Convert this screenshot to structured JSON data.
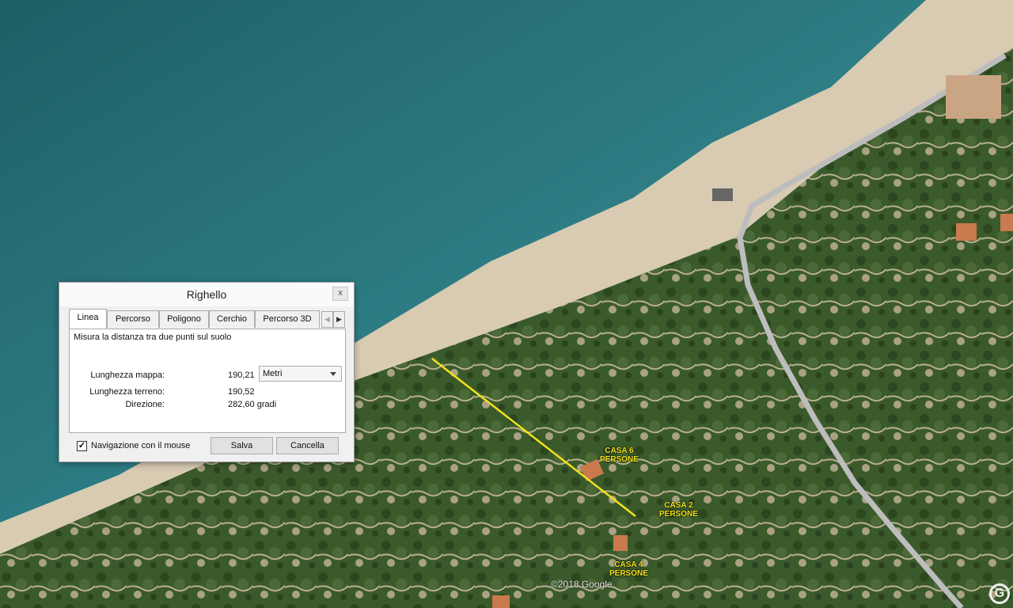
{
  "map": {
    "copyright": "©2018 Google",
    "logo": "G",
    "labels": [
      {
        "line1": "CASA 6",
        "line2": "PERSONE"
      },
      {
        "line1": "CASA 2",
        "line2": "PERSONE"
      },
      {
        "line1": "CASA 4",
        "line2": "PERSONE"
      }
    ],
    "colors": {
      "sea": "#2f7f86",
      "sand": "#d9cbb0",
      "vegetation": "#3d5a2c",
      "road": "#b8b8b8",
      "measure_line": "#f2e21a"
    }
  },
  "dialog": {
    "title": "Righello",
    "close_label": "x",
    "tabs": [
      {
        "label": "Linea"
      },
      {
        "label": "Percorso"
      },
      {
        "label": "Poligono"
      },
      {
        "label": "Cerchio"
      },
      {
        "label": "Percorso 3D"
      }
    ],
    "description": "Misura la distanza tra due punti sul suolo",
    "map_length_label": "Lunghezza mappa:",
    "map_length_value": "190,21",
    "unit_selected": "Metri",
    "ground_length_label": "Lunghezza terreno:",
    "ground_length_value": "190,52",
    "heading_label": "Direzione:",
    "heading_value": "282,60 gradi",
    "mouse_nav_checked": "✓",
    "mouse_nav_label": "Navigazione con il mouse",
    "save_label": "Salva",
    "cancel_label": "Cancella"
  }
}
